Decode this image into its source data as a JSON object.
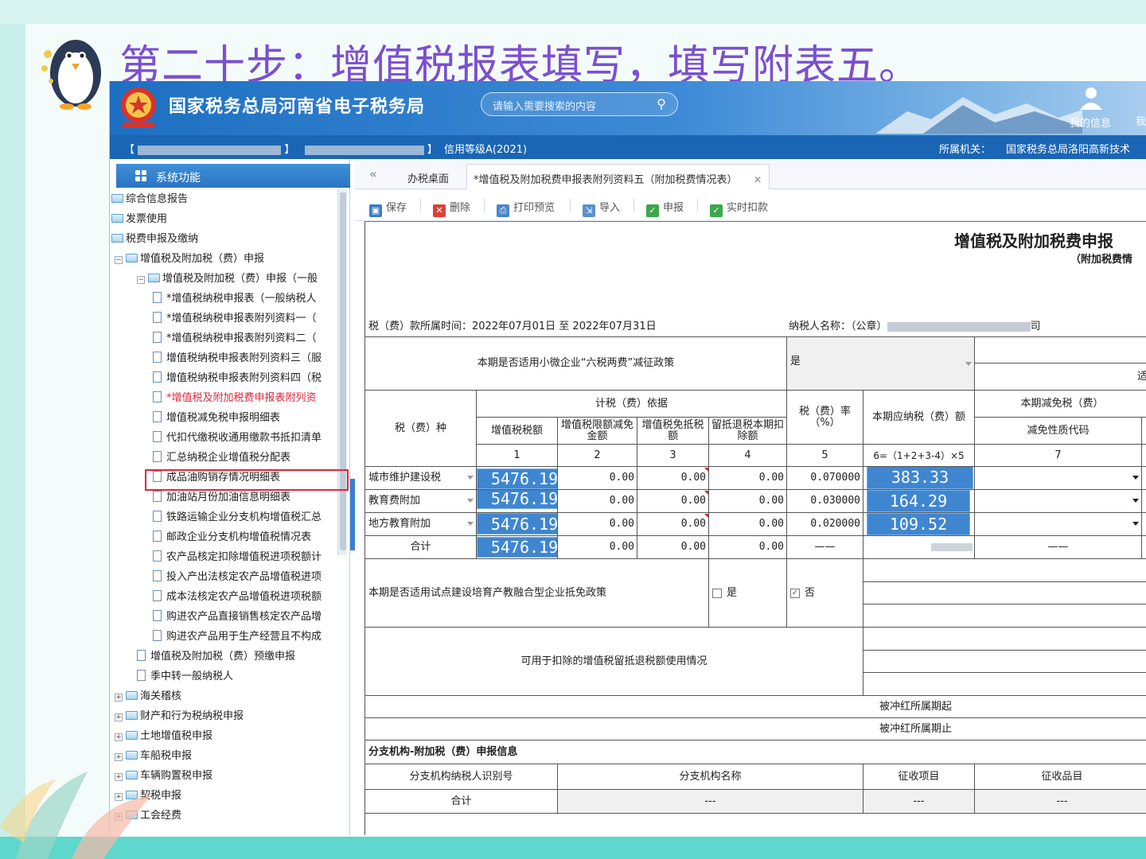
{
  "slide": {
    "title": "第二十步：增值税报表填写，填写附表五。"
  },
  "header": {
    "brand": "国家税务总局河南省电子税务局",
    "search_placeholder": "请输入需要搜索的内容",
    "my_info": "我的信息",
    "cut_text": "我"
  },
  "infobar": {
    "credit": "信用等级A(2021)",
    "authority_label": "所属机关：",
    "authority": "国家税务总局洛阳高新技术"
  },
  "sidebar": {
    "title": "系统功能",
    "items": [
      {
        "label": "综合信息报告"
      },
      {
        "label": "发票使用"
      },
      {
        "label": "税费申报及缴纳"
      },
      {
        "label": "增值税及附加税（费）申报"
      },
      {
        "label": "增值税及附加税（费）申报（一般"
      },
      {
        "label": "*增值税纳税申报表（一般纳税人"
      },
      {
        "label": "*增值税纳税申报表附列资料一（"
      },
      {
        "label": "*增值税纳税申报表附列资料二（"
      },
      {
        "label": "增值税纳税申报表附列资料三（服"
      },
      {
        "label": "增值税纳税申报表附列资料四（税"
      },
      {
        "label": "*增值税及附加税费申报表附列资"
      },
      {
        "label": "增值税减免税申报明细表"
      },
      {
        "label": "代扣代缴税收通用缴款书抵扣清单"
      },
      {
        "label": "汇总纳税企业增值税分配表"
      },
      {
        "label": "成品油购销存情况明细表"
      },
      {
        "label": "加油站月份加油信息明细表"
      },
      {
        "label": "铁路运输企业分支机构增值税汇总"
      },
      {
        "label": "邮政企业分支机构增值税情况表"
      },
      {
        "label": "农产品核定扣除增值税进项税额计"
      },
      {
        "label": "投入产出法核定农产品增值税进项"
      },
      {
        "label": "成本法核定农产品增值税进项税额"
      },
      {
        "label": "购进农产品直接销售核定农产品增"
      },
      {
        "label": "购进农产品用于生产经营且不构成"
      },
      {
        "label": "增值税及附加税（费）预缴申报"
      },
      {
        "label": "季中转一般纳税人"
      },
      {
        "label": "海关稽核"
      },
      {
        "label": "财产和行为税纳税申报"
      },
      {
        "label": "土地增值税申报"
      },
      {
        "label": "车船税申报"
      },
      {
        "label": "车辆购置税申报"
      },
      {
        "label": "契税申报"
      },
      {
        "label": "工会经费"
      }
    ]
  },
  "tabs": {
    "home": "办税桌面",
    "active": "*增值税及附加税费申报表附列资料五（附加税费情况表）",
    "close": "×"
  },
  "toolbar": {
    "save": "保存",
    "delete": "删除",
    "print": "打印预览",
    "import": "导入",
    "declare": "申报",
    "deduct": "实时扣款"
  },
  "form": {
    "title": "增值税及附加税费申报",
    "subtitle": "（附加税费情",
    "period": "税（费）款所属时间：2022年07月01日 至 2022年07月31日",
    "taxpayer_label": "纳税人名称：（公章）",
    "taxpayer_suffix": "司",
    "small_policy_label": "本期是否适用小微企业“六税两费”减征政策",
    "small_policy_value": "是",
    "right_top_cut": "适",
    "headers": {
      "tax_type": "税（费）种",
      "basis": "计税（费）依据",
      "vat": "增值税税额",
      "limit_reduction": "增值税限额减免金额",
      "exempt_credit": "增值税免抵税额",
      "refund_deduction": "留抵退税本期扣除额",
      "rate": "税（费）率（%）",
      "payable": "本期应纳税（费）额",
      "reduction": "本期减免税（费）",
      "reduction_code": "减免性质代码",
      "n1": "1",
      "n2": "2",
      "n3": "3",
      "n4": "4",
      "n5": "5",
      "n6": "6=（1+2+3-4）×5",
      "n7": "7"
    },
    "rows": [
      {
        "name": "城市维护建设税",
        "vat": "5476.19",
        "c2": "0.00",
        "c3": "0.00",
        "c4": "0.00",
        "rate": "0.070000",
        "payable": "383.33"
      },
      {
        "name": "教育费附加",
        "vat": "5476.19",
        "c2": "0.00",
        "c3": "0.00",
        "c4": "0.00",
        "rate": "0.030000",
        "payable": "164.29"
      },
      {
        "name": "地方教育附加",
        "vat": "5476.19",
        "c2": "0.00",
        "c3": "0.00",
        "c4": "0.00",
        "rate": "0.020000",
        "payable": "109.52"
      }
    ],
    "total": {
      "label": "合计",
      "vat": "5476.19",
      "c2": "0.00",
      "c3": "0.00",
      "c4": "0.00",
      "rate": "——",
      "code": "——"
    },
    "pilot_label": "本期是否适用试点建设培育产教融合型企业抵免政策",
    "pilot_yes": "是",
    "pilot_no": "否",
    "retained_label": "可用于扣除的增值税留抵退税额使用情况",
    "offset_start": "被冲红所属期起",
    "offset_end": "被冲红所属期止",
    "branch_title": "分支机构-附加税（费）申报信息",
    "branch_headers": {
      "id": "分支机构纳税人识别号",
      "name": "分支机构名称",
      "item": "征收项目",
      "subitem": "征收品目"
    },
    "branch_total": {
      "label": "合计",
      "name": "---",
      "item": "---",
      "subitem": "---"
    }
  },
  "colors": {
    "brand_blue": "#1e6fc1",
    "title_purple": "#7b4fd0",
    "highlight_blue": "#3f86d1",
    "highlight_red": "#e0263c"
  }
}
